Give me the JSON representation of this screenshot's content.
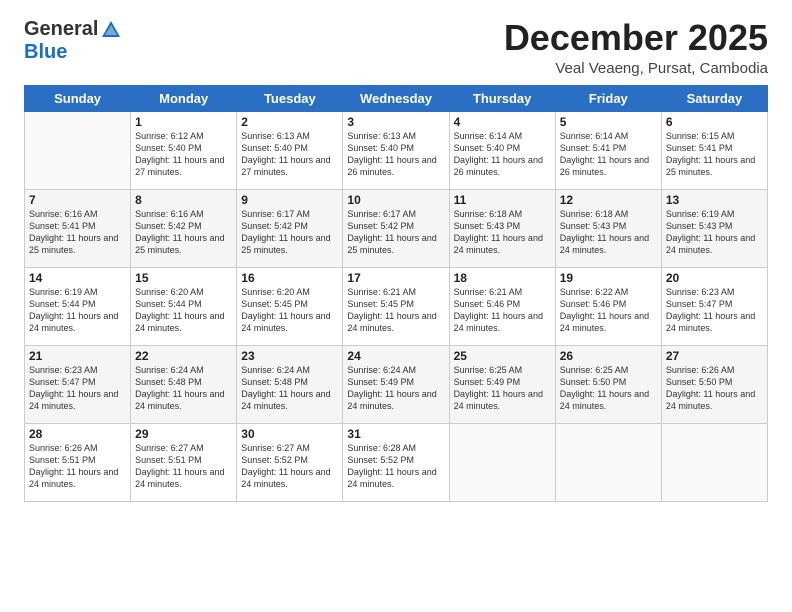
{
  "header": {
    "logo_general": "General",
    "logo_blue": "Blue",
    "title": "December 2025",
    "location": "Veal Veaeng, Pursat, Cambodia"
  },
  "days_of_week": [
    "Sunday",
    "Monday",
    "Tuesday",
    "Wednesday",
    "Thursday",
    "Friday",
    "Saturday"
  ],
  "weeks": [
    [
      {
        "day": "",
        "sunrise": "",
        "sunset": "",
        "daylight": ""
      },
      {
        "day": "1",
        "sunrise": "Sunrise: 6:12 AM",
        "sunset": "Sunset: 5:40 PM",
        "daylight": "Daylight: 11 hours and 27 minutes."
      },
      {
        "day": "2",
        "sunrise": "Sunrise: 6:13 AM",
        "sunset": "Sunset: 5:40 PM",
        "daylight": "Daylight: 11 hours and 27 minutes."
      },
      {
        "day": "3",
        "sunrise": "Sunrise: 6:13 AM",
        "sunset": "Sunset: 5:40 PM",
        "daylight": "Daylight: 11 hours and 26 minutes."
      },
      {
        "day": "4",
        "sunrise": "Sunrise: 6:14 AM",
        "sunset": "Sunset: 5:40 PM",
        "daylight": "Daylight: 11 hours and 26 minutes."
      },
      {
        "day": "5",
        "sunrise": "Sunrise: 6:14 AM",
        "sunset": "Sunset: 5:41 PM",
        "daylight": "Daylight: 11 hours and 26 minutes."
      },
      {
        "day": "6",
        "sunrise": "Sunrise: 6:15 AM",
        "sunset": "Sunset: 5:41 PM",
        "daylight": "Daylight: 11 hours and 25 minutes."
      }
    ],
    [
      {
        "day": "7",
        "sunrise": "Sunrise: 6:16 AM",
        "sunset": "Sunset: 5:41 PM",
        "daylight": "Daylight: 11 hours and 25 minutes."
      },
      {
        "day": "8",
        "sunrise": "Sunrise: 6:16 AM",
        "sunset": "Sunset: 5:42 PM",
        "daylight": "Daylight: 11 hours and 25 minutes."
      },
      {
        "day": "9",
        "sunrise": "Sunrise: 6:17 AM",
        "sunset": "Sunset: 5:42 PM",
        "daylight": "Daylight: 11 hours and 25 minutes."
      },
      {
        "day": "10",
        "sunrise": "Sunrise: 6:17 AM",
        "sunset": "Sunset: 5:42 PM",
        "daylight": "Daylight: 11 hours and 25 minutes."
      },
      {
        "day": "11",
        "sunrise": "Sunrise: 6:18 AM",
        "sunset": "Sunset: 5:43 PM",
        "daylight": "Daylight: 11 hours and 24 minutes."
      },
      {
        "day": "12",
        "sunrise": "Sunrise: 6:18 AM",
        "sunset": "Sunset: 5:43 PM",
        "daylight": "Daylight: 11 hours and 24 minutes."
      },
      {
        "day": "13",
        "sunrise": "Sunrise: 6:19 AM",
        "sunset": "Sunset: 5:43 PM",
        "daylight": "Daylight: 11 hours and 24 minutes."
      }
    ],
    [
      {
        "day": "14",
        "sunrise": "Sunrise: 6:19 AM",
        "sunset": "Sunset: 5:44 PM",
        "daylight": "Daylight: 11 hours and 24 minutes."
      },
      {
        "day": "15",
        "sunrise": "Sunrise: 6:20 AM",
        "sunset": "Sunset: 5:44 PM",
        "daylight": "Daylight: 11 hours and 24 minutes."
      },
      {
        "day": "16",
        "sunrise": "Sunrise: 6:20 AM",
        "sunset": "Sunset: 5:45 PM",
        "daylight": "Daylight: 11 hours and 24 minutes."
      },
      {
        "day": "17",
        "sunrise": "Sunrise: 6:21 AM",
        "sunset": "Sunset: 5:45 PM",
        "daylight": "Daylight: 11 hours and 24 minutes."
      },
      {
        "day": "18",
        "sunrise": "Sunrise: 6:21 AM",
        "sunset": "Sunset: 5:46 PM",
        "daylight": "Daylight: 11 hours and 24 minutes."
      },
      {
        "day": "19",
        "sunrise": "Sunrise: 6:22 AM",
        "sunset": "Sunset: 5:46 PM",
        "daylight": "Daylight: 11 hours and 24 minutes."
      },
      {
        "day": "20",
        "sunrise": "Sunrise: 6:23 AM",
        "sunset": "Sunset: 5:47 PM",
        "daylight": "Daylight: 11 hours and 24 minutes."
      }
    ],
    [
      {
        "day": "21",
        "sunrise": "Sunrise: 6:23 AM",
        "sunset": "Sunset: 5:47 PM",
        "daylight": "Daylight: 11 hours and 24 minutes."
      },
      {
        "day": "22",
        "sunrise": "Sunrise: 6:24 AM",
        "sunset": "Sunset: 5:48 PM",
        "daylight": "Daylight: 11 hours and 24 minutes."
      },
      {
        "day": "23",
        "sunrise": "Sunrise: 6:24 AM",
        "sunset": "Sunset: 5:48 PM",
        "daylight": "Daylight: 11 hours and 24 minutes."
      },
      {
        "day": "24",
        "sunrise": "Sunrise: 6:24 AM",
        "sunset": "Sunset: 5:49 PM",
        "daylight": "Daylight: 11 hours and 24 minutes."
      },
      {
        "day": "25",
        "sunrise": "Sunrise: 6:25 AM",
        "sunset": "Sunset: 5:49 PM",
        "daylight": "Daylight: 11 hours and 24 minutes."
      },
      {
        "day": "26",
        "sunrise": "Sunrise: 6:25 AM",
        "sunset": "Sunset: 5:50 PM",
        "daylight": "Daylight: 11 hours and 24 minutes."
      },
      {
        "day": "27",
        "sunrise": "Sunrise: 6:26 AM",
        "sunset": "Sunset: 5:50 PM",
        "daylight": "Daylight: 11 hours and 24 minutes."
      }
    ],
    [
      {
        "day": "28",
        "sunrise": "Sunrise: 6:26 AM",
        "sunset": "Sunset: 5:51 PM",
        "daylight": "Daylight: 11 hours and 24 minutes."
      },
      {
        "day": "29",
        "sunrise": "Sunrise: 6:27 AM",
        "sunset": "Sunset: 5:51 PM",
        "daylight": "Daylight: 11 hours and 24 minutes."
      },
      {
        "day": "30",
        "sunrise": "Sunrise: 6:27 AM",
        "sunset": "Sunset: 5:52 PM",
        "daylight": "Daylight: 11 hours and 24 minutes."
      },
      {
        "day": "31",
        "sunrise": "Sunrise: 6:28 AM",
        "sunset": "Sunset: 5:52 PM",
        "daylight": "Daylight: 11 hours and 24 minutes."
      },
      {
        "day": "",
        "sunrise": "",
        "sunset": "",
        "daylight": ""
      },
      {
        "day": "",
        "sunrise": "",
        "sunset": "",
        "daylight": ""
      },
      {
        "day": "",
        "sunrise": "",
        "sunset": "",
        "daylight": ""
      }
    ]
  ]
}
